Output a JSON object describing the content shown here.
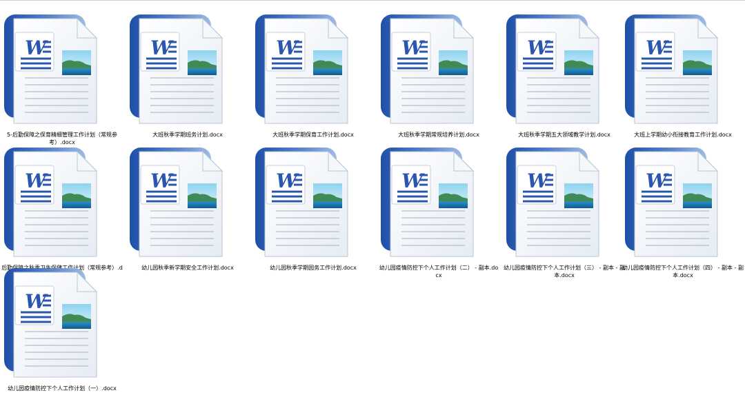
{
  "files": [
    {
      "name": "5-后勤保障之保育精细管理工作计划（常规参考）.docx",
      "icon": "word-document-icon"
    },
    {
      "name": "大班秋季学期班务计划.docx",
      "icon": "word-document-icon"
    },
    {
      "name": "大班秋季学期保育工作计划.docx",
      "icon": "word-document-icon"
    },
    {
      "name": "大班秋季学期常规培养计划.docx",
      "icon": "word-document-icon"
    },
    {
      "name": "大班秋季学期五大领域教学计划.docx",
      "icon": "word-document-icon"
    },
    {
      "name": "大班上学期幼小衔接教育工作计划.docx",
      "icon": "word-document-icon"
    },
    {
      "name": "后勤保障之秋季卫生保健工作计划（常规参考）.docx",
      "icon": "word-document-icon"
    },
    {
      "name": "幼儿园秋季新学期安全工作计划.docx",
      "icon": "word-document-icon"
    },
    {
      "name": "幼儿园秋季学期园务工作计划.docx",
      "icon": "word-document-icon"
    },
    {
      "name": "幼儿园疫情防控下个人工作计划（二） - 副本.docx",
      "icon": "word-document-icon"
    },
    {
      "name": "幼儿园疫情防控下个人工作计划（三） - 副本 - 副本.docx",
      "icon": "word-document-icon"
    },
    {
      "name": "幼儿园疫情防控下个人工作计划（四） - 副本 - 副本.docx",
      "icon": "word-document-icon"
    },
    {
      "name": "幼儿园疫情防控下个人工作计划（一）.docx",
      "icon": "word-document-icon"
    }
  ],
  "colors": {
    "icon_blue": "#2a56b0",
    "page_lines": "#b5bec9",
    "label_text": "#000000"
  }
}
